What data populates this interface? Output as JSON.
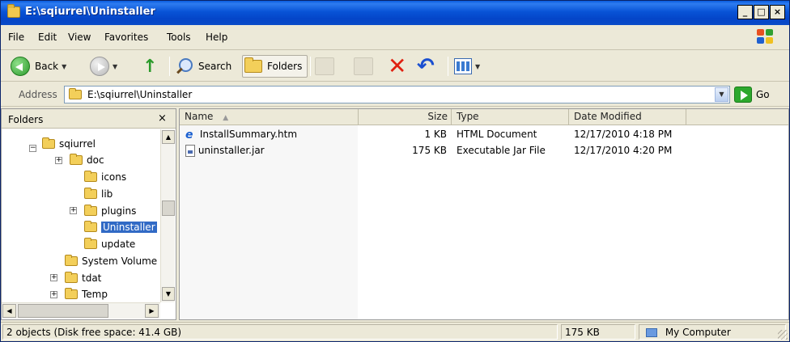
{
  "window": {
    "title": "E:\\sqiurrel\\Uninstaller",
    "controls": [
      "_",
      "□",
      "×"
    ]
  },
  "menu": [
    "File",
    "Edit",
    "View",
    "Favorites",
    "Tools",
    "Help"
  ],
  "toolbar": {
    "back_label": "Back",
    "search_label": "Search",
    "folders_label": "Folders"
  },
  "address": {
    "label": "Address",
    "value": "E:\\sqiurrel\\Uninstaller",
    "go_label": "Go"
  },
  "folders_pane": {
    "title": "Folders",
    "close": "×",
    "tree": [
      {
        "label": "sqiurrel",
        "expander": "−"
      },
      {
        "label": "doc",
        "expander": "+"
      },
      {
        "label": "icons",
        "expander": ""
      },
      {
        "label": "lib",
        "expander": ""
      },
      {
        "label": "plugins",
        "expander": "+"
      },
      {
        "label": "Uninstaller",
        "expander": "",
        "selected": true
      },
      {
        "label": "update",
        "expander": ""
      },
      {
        "label": "System Volume",
        "expander": ""
      },
      {
        "label": "tdat",
        "expander": "+"
      },
      {
        "label": "Temp",
        "expander": "+"
      }
    ]
  },
  "file_list": {
    "columns": [
      "Name",
      "Size",
      "Type",
      "Date Modified"
    ],
    "rows": [
      {
        "name": "InstallSummary.htm",
        "size": "1 KB",
        "type": "HTML Document",
        "date": "12/17/2010 4:18 PM",
        "icon": "ie-document-icon"
      },
      {
        "name": "uninstaller.jar",
        "size": "175 KB",
        "type": "Executable Jar File",
        "date": "12/17/2010 4:20 PM",
        "icon": "jar-file-icon"
      }
    ]
  },
  "status": {
    "objects": "2 objects (Disk free space: 41.4 GB)",
    "size": "175 KB",
    "location": "My Computer"
  },
  "colors": {
    "titlebar": "#0a5ce0",
    "selection": "#316ac5",
    "chrome": "#ece9d8"
  }
}
